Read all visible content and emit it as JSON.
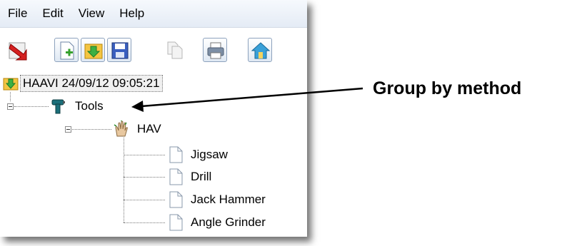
{
  "menu": {
    "items": [
      "File",
      "Edit",
      "View",
      "Help"
    ]
  },
  "toolbar": {
    "buttons": [
      {
        "icon": "exit-icon"
      },
      {
        "icon": "new-document-icon"
      },
      {
        "icon": "open-icon"
      },
      {
        "icon": "save-icon"
      },
      {
        "icon": "copy-icon"
      },
      {
        "icon": "print-icon"
      },
      {
        "icon": "home-icon"
      }
    ]
  },
  "tree": {
    "root": {
      "label": "HAAVI 24/09/12 09:05:21",
      "icon": "folder-download-icon"
    },
    "group": {
      "label": "Tools",
      "icon": "drill-icon"
    },
    "subgroup": {
      "label": "HAV",
      "icon": "hand-icon"
    },
    "items": [
      {
        "label": "Jigsaw",
        "icon": "document-icon"
      },
      {
        "label": "Drill",
        "icon": "document-icon"
      },
      {
        "label": "Jack Hammer",
        "icon": "document-icon"
      },
      {
        "label": "Angle Grinder",
        "icon": "document-icon"
      }
    ]
  },
  "annotation": {
    "text": "Group by method"
  }
}
